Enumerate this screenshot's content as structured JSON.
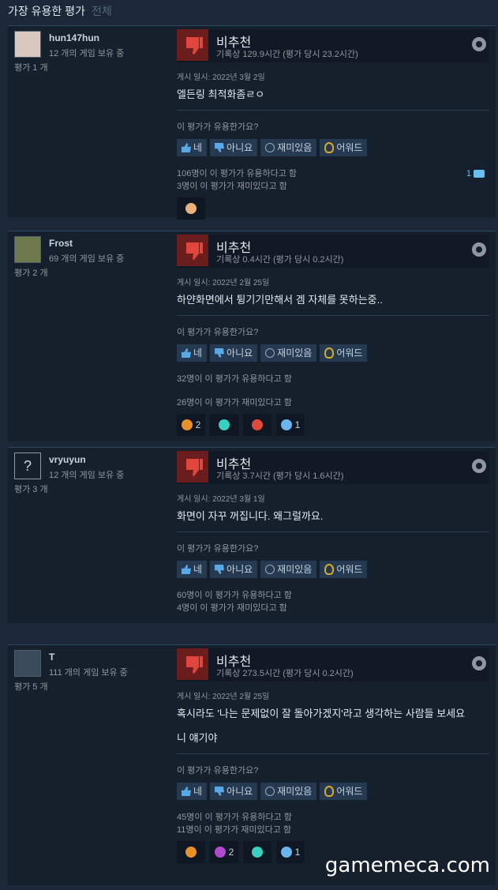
{
  "tabs": {
    "active": "가장 유용한 평가",
    "other": "전체"
  },
  "common": {
    "verdict": "비추천",
    "question": "이 평가가 유용한가요?",
    "yes": "네",
    "no": "아니요",
    "funny": "재미있음",
    "award": "어워드"
  },
  "reviews": [
    {
      "username": "hun147hun",
      "owned": "12 개의 게임 보유 중",
      "review_count": "평가 1 개",
      "hours": "기록상 129.9시간 (평가 당시 23.2시간)",
      "posted": "게시 일시: 2022년 3월 2일",
      "text": "엘든링 최적화좀ㄹㅇ",
      "helpful": "106명이 이 평가가 유용하다고 함",
      "funny_count": "3명이 이 평가가 재미있다고 함",
      "comments": "1"
    },
    {
      "username": "Frost",
      "owned": "69 개의 게임 보유 중",
      "review_count": "평가 2 개",
      "hours": "기록상 0.4시간 (평가 당시 0.2시간)",
      "posted": "게시 일시: 2022년 2월 25일",
      "text": "하얀화면에서 튕기기만해서 겜 자체를 못하는중..",
      "helpful": "32명이 이 평가가 유용하다고 함",
      "funny_count": "26명이 이 평가가 재미있다고 함",
      "award1": "2",
      "award4": "1"
    },
    {
      "username": "vryuyun",
      "owned": "12 개의 게임 보유 중",
      "review_count": "평가 3 개",
      "hours": "기록상 3.7시간 (평가 당시 1.6시간)",
      "posted": "게시 일시: 2022년 3월 1일",
      "text": "화면이 자꾸 꺼집니다. 왜그럴까요.",
      "helpful": "60명이 이 평가가 유용하다고 함",
      "funny_count": "4명이 이 평가가 재미있다고 함"
    },
    {
      "username": "T",
      "owned": "111 개의 게임 보유 중",
      "review_count": "평가 5 개",
      "hours": "기록상 273.5시간 (평가 당시 0.2시간)",
      "posted": "게시 일시: 2022년 2월 25일",
      "text": "혹시라도 '나는 문제없이 잘 돌아가겠지'라고 생각하는 사람들 보세요",
      "text2": "니 얘기야",
      "helpful": "45명이 이 평가가 유용하다고 함",
      "funny_count": "11명이 이 평가가 재미있다고 함",
      "award2": "2",
      "award4": "1"
    }
  ],
  "watermark": "gamemeca.com",
  "colors": {
    "background": "#1b2838",
    "card": "#16202d",
    "thumb_down": "#6b1c1c",
    "link": "#66c0f4"
  }
}
